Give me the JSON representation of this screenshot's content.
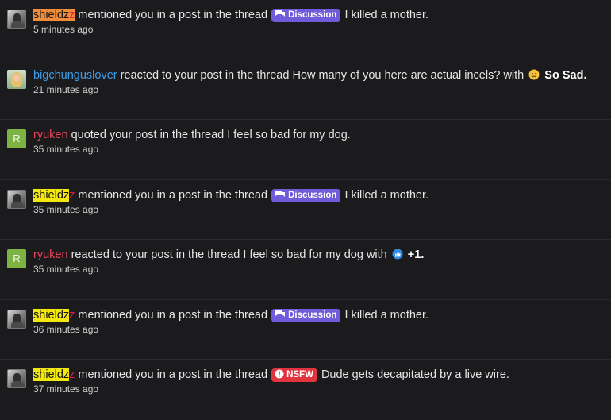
{
  "notifications": [
    {
      "avatar": "photo",
      "user_parts": [
        "shieldz",
        "z"
      ],
      "user_style": "highlight-orange",
      "text": "mentioned you in a post in the thread",
      "prefix": {
        "label": "Discussion",
        "type": "discussion",
        "icon": "chat-bubbles-icon"
      },
      "thread": "I killed a mother.",
      "time": "5 minutes ago"
    },
    {
      "avatar": "photo-blonde",
      "user": "bigchunguslover",
      "user_color": "#3f9ee8",
      "text": "reacted to your post in the thread How many of you here are actual incels? with",
      "reaction": {
        "icon": "sad-face-icon",
        "label": "So Sad."
      },
      "time": "21 minutes ago"
    },
    {
      "avatar": "letter",
      "avatar_letter": "R",
      "user": "ryuken",
      "user_color": "#e8455a",
      "text": "quoted your post in the thread I feel so bad for my dog.",
      "time": "35 minutes ago"
    },
    {
      "avatar": "photo",
      "user_parts": [
        "shieldz",
        "z"
      ],
      "user_style": "highlight-yellow",
      "text": "mentioned you in a post in the thread",
      "prefix": {
        "label": "Discussion",
        "type": "discussion",
        "icon": "chat-bubbles-icon"
      },
      "thread": "I killed a mother.",
      "time": "35 minutes ago"
    },
    {
      "avatar": "letter",
      "avatar_letter": "R",
      "user": "ryuken",
      "user_color": "#e8455a",
      "text": "reacted to your post in the thread I feel so bad for my dog with",
      "reaction": {
        "icon": "thumbs-up-icon",
        "label": "+1."
      },
      "time": "35 minutes ago"
    },
    {
      "avatar": "photo",
      "user_parts": [
        "shieldz",
        "z"
      ],
      "user_style": "highlight-yellow",
      "text": "mentioned you in a post in the thread",
      "prefix": {
        "label": "Discussion",
        "type": "discussion",
        "icon": "chat-bubbles-icon"
      },
      "thread": "I killed a mother.",
      "time": "36 minutes ago"
    },
    {
      "avatar": "photo",
      "user_parts": [
        "shieldz",
        "z"
      ],
      "user_style": "highlight-yellow",
      "text": "mentioned you in a post in the thread",
      "prefix": {
        "label": "NSFW",
        "type": "nsfw",
        "icon": "alert-icon"
      },
      "thread": "Dude gets decapitated by a live wire.",
      "time": "37 minutes ago"
    }
  ],
  "colors": {
    "background": "#1b1b1d",
    "discussion_badge": "#6e5cda",
    "nsfw_badge": "#e0353e",
    "username_highlight_yellow": "#f3e80d",
    "username_highlight_orange": "#f18c3a"
  }
}
